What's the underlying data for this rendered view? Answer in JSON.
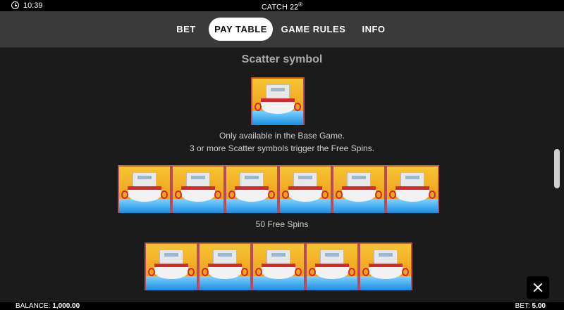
{
  "status_bar": {
    "time": "10:39",
    "title": "CATCH 22",
    "title_mark": "®"
  },
  "nav": {
    "tabs": [
      {
        "label": "BET",
        "active": false
      },
      {
        "label": "PAY TABLE",
        "active": true
      },
      {
        "label": "GAME RULES",
        "active": false
      },
      {
        "label": "INFO",
        "active": false
      }
    ]
  },
  "content": {
    "section_title": "Scatter symbol",
    "description_line1": "Only available in the Base Game.",
    "description_line2": "3 or more Scatter symbols trigger the Free Spins.",
    "row1_caption": "50 Free Spins",
    "scatter_icon": "boat-scatter-icon"
  },
  "footer": {
    "balance_label": "BALANCE:",
    "balance_value": "1,000.00",
    "bet_label": "BET:",
    "bet_value": "5.00"
  },
  "colors": {
    "nav_bg": "#3a3a3a",
    "content_bg": "#1b1b1b",
    "active_tab_bg": "#ffffff"
  }
}
